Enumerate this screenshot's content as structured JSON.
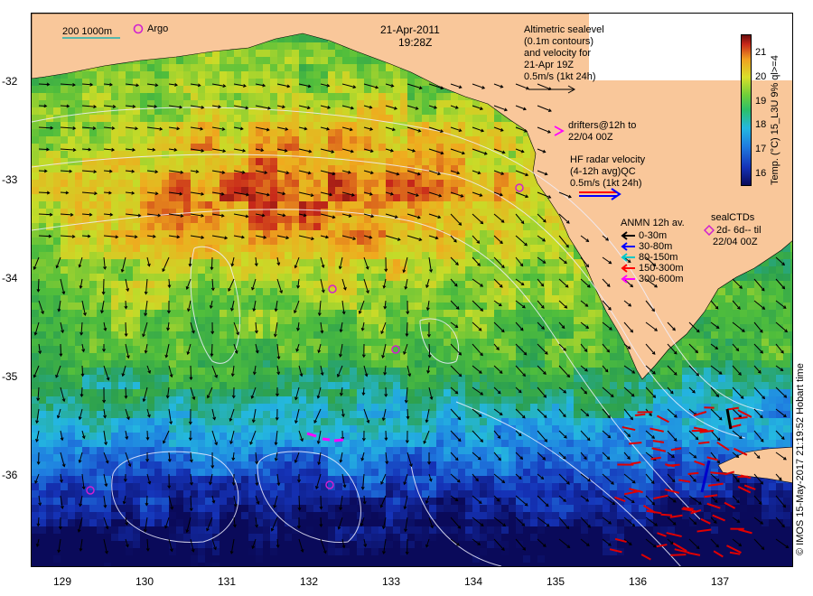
{
  "header": {
    "date": "21-Apr-2011",
    "time": "19:28Z"
  },
  "scale_legend": {
    "depths": "200  1000m",
    "argo_label": "Argo"
  },
  "altimetric_note": [
    "Altimetric sealevel",
    "(0.1m contours)",
    "and velocity for",
    "21-Apr 19Z",
    "0.5m/s (1kt 24h)"
  ],
  "drifters_note": [
    "drifters@12h to",
    "22/04 00Z"
  ],
  "hf_radar_note": [
    "HF radar velocity",
    "(4-12h avg)QC",
    "0.5m/s (1kt 24h)"
  ],
  "anmn_legend": {
    "title": "ANMN 12h av.",
    "items": [
      {
        "label": "0-30m",
        "color": "#000000"
      },
      {
        "label": "30-80m",
        "color": "#0000ff"
      },
      {
        "label": "80-150m",
        "color": "#00c8c8"
      },
      {
        "label": "150-300m",
        "color": "#ff0000"
      },
      {
        "label": "300-600m",
        "color": "#ff00ff"
      }
    ]
  },
  "seal_ctd": {
    "title": "sealCTDs",
    "line1": "2d- 6d-- til",
    "line2": "22/04 00Z"
  },
  "colorbar": {
    "label": "Temp. (°C) 15_L3U 9% ql>=4",
    "ticks": [
      "21",
      "20",
      "19",
      "18",
      "17",
      "16"
    ],
    "range": [
      15.5,
      21.8
    ]
  },
  "credit": "© IMOS 15-May-2017 21:19:52 Hobart time",
  "axes": {
    "lat_ticks": [
      "-32",
      "-33",
      "-34",
      "-35",
      "-36"
    ],
    "lon_ticks": [
      "129",
      "130",
      "131",
      "132",
      "133",
      "134",
      "135",
      "136",
      "137"
    ]
  },
  "colors": {
    "land": "#f9c79a",
    "argo": "#d020d0"
  }
}
